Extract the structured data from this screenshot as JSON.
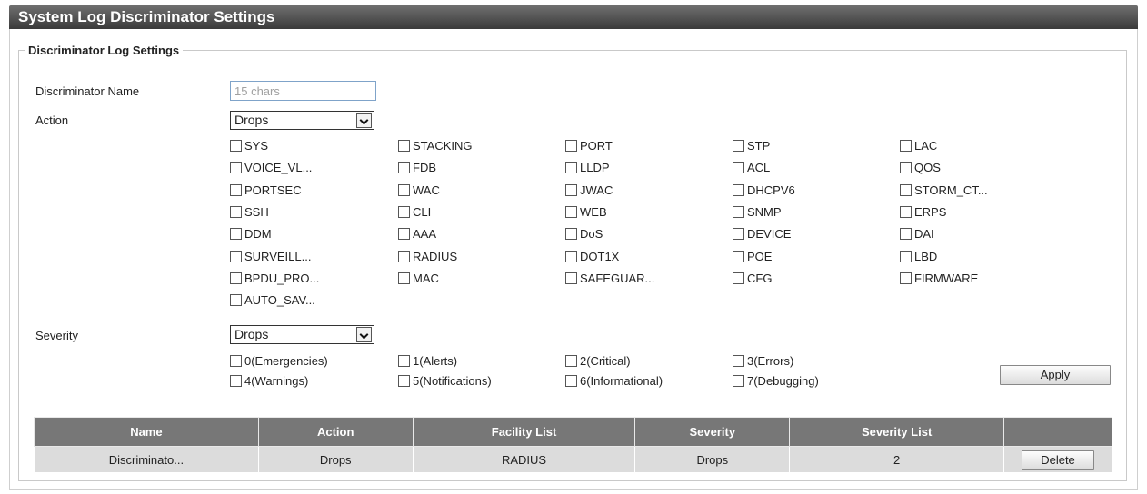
{
  "page": {
    "title": "System Log Discriminator Settings"
  },
  "section": {
    "legend": "Discriminator Log Settings"
  },
  "form": {
    "name_label": "Discriminator Name",
    "name_placeholder": "15 chars",
    "name_value": "",
    "action_label": "Action",
    "action_value": "Drops",
    "severity_label": "Severity",
    "severity_value": "Drops"
  },
  "facilities": [
    "SYS",
    "STACKING",
    "PORT",
    "STP",
    "LAC",
    "VOICE_VL...",
    "FDB",
    "LLDP",
    "ACL",
    "QOS",
    "PORTSEC",
    "WAC",
    "JWAC",
    "DHCPV6",
    "STORM_CT...",
    "SSH",
    "CLI",
    "WEB",
    "SNMP",
    "ERPS",
    "DDM",
    "AAA",
    "DoS",
    "DEVICE",
    "DAI",
    "SURVEILL...",
    "RADIUS",
    "DOT1X",
    "POE",
    "LBD",
    "BPDU_PRO...",
    "MAC",
    "SAFEGUAR...",
    "CFG",
    "FIRMWARE",
    "AUTO_SAV..."
  ],
  "severities": [
    "0(Emergencies)",
    "1(Alerts)",
    "2(Critical)",
    "3(Errors)",
    "4(Warnings)",
    "5(Notifications)",
    "6(Informational)",
    "7(Debugging)"
  ],
  "buttons": {
    "apply": "Apply",
    "delete": "Delete"
  },
  "table": {
    "headers": [
      "Name",
      "Action",
      "Facility List",
      "Severity",
      "Severity List",
      ""
    ],
    "rows": [
      {
        "name": "Discriminato...",
        "action": "Drops",
        "facility": "RADIUS",
        "severity": "Drops",
        "severity_list": "2"
      }
    ]
  }
}
